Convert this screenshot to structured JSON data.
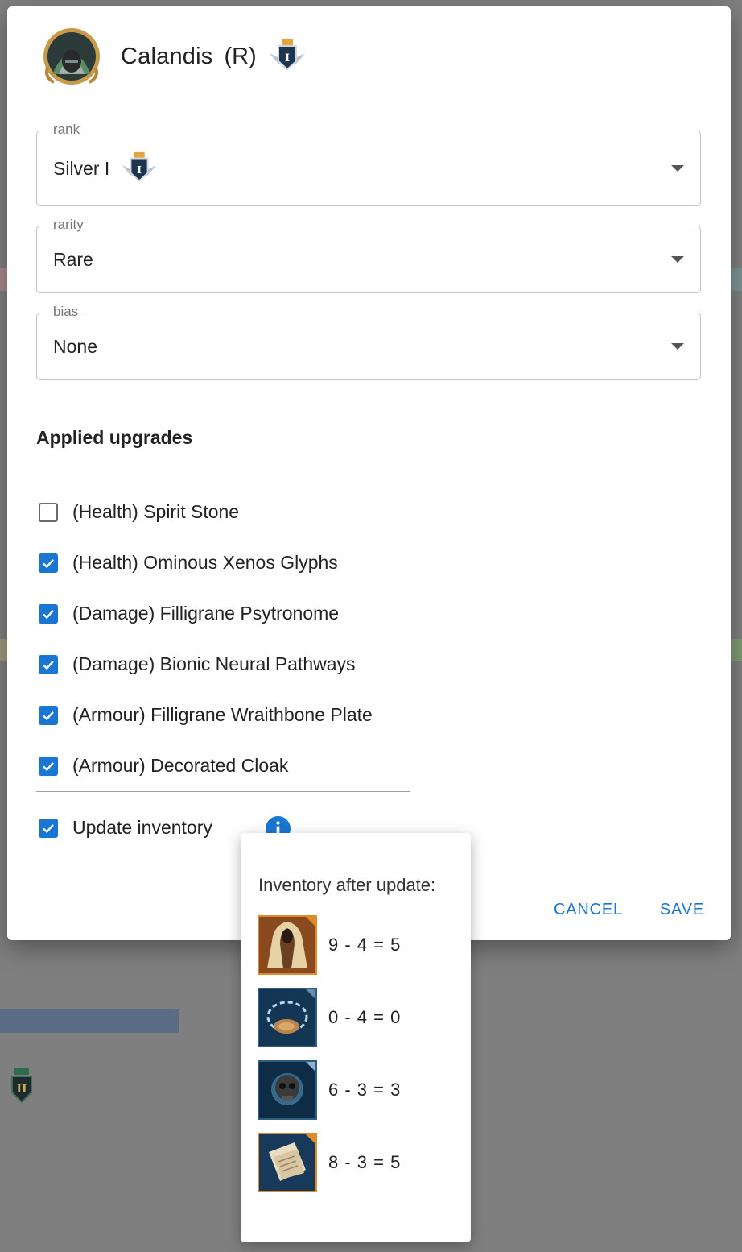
{
  "dialog": {
    "character": {
      "name": "Calandis",
      "rarity_tag": "(R)"
    },
    "fields": {
      "rank": {
        "label": "rank",
        "value": "Silver I"
      },
      "rarity": {
        "label": "rarity",
        "value": "Rare"
      },
      "bias": {
        "label": "bias",
        "value": "None"
      }
    },
    "upgrades_title": "Applied upgrades",
    "upgrades": [
      {
        "label": "(Health) Spirit Stone",
        "checked": false
      },
      {
        "label": "(Health) Ominous Xenos Glyphs",
        "checked": true
      },
      {
        "label": "(Damage) Filligrane Psytronome",
        "checked": true
      },
      {
        "label": "(Damage) Bionic Neural Pathways",
        "checked": true
      },
      {
        "label": "(Armour) Filligrane Wraithbone Plate",
        "checked": true
      },
      {
        "label": "(Armour) Decorated Cloak",
        "checked": true
      }
    ],
    "update_inventory": {
      "label": "Update inventory",
      "checked": true
    },
    "actions": {
      "cancel": "CANCEL",
      "save": "SAVE"
    }
  },
  "popover": {
    "title": "Inventory after update:",
    "items": [
      {
        "icon": "cloak-icon",
        "text": "9 - 4 = 5",
        "border": "#e08a2c"
      },
      {
        "icon": "chain-rope-icon",
        "text": "0 - 4 = 0",
        "border": "#2b5f86"
      },
      {
        "icon": "skull-icon",
        "text": "6 - 3 = 3",
        "border": "#2b5f86"
      },
      {
        "icon": "scroll-pages-icon",
        "text": "8 - 3 = 5",
        "border": "#e08a2c"
      }
    ]
  },
  "colors": {
    "accent": "#1976d2",
    "overlay": "#7f7f7f"
  }
}
